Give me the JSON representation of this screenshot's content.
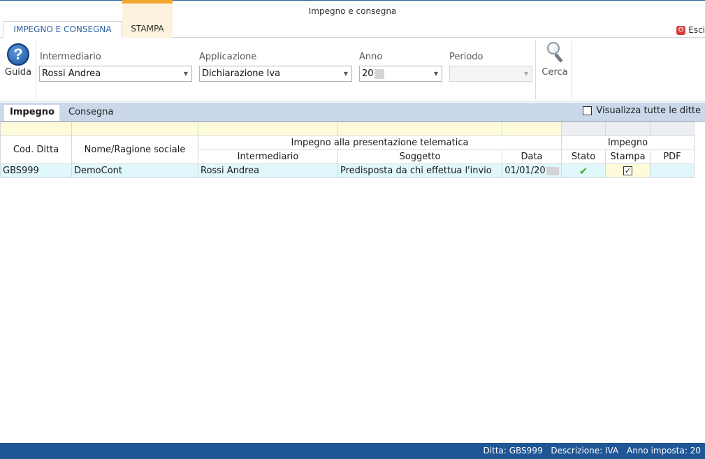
{
  "window": {
    "title": "Impegno e consegna"
  },
  "ribbon": {
    "tabs": [
      {
        "label": "IMPEGNO E CONSEGNA"
      },
      {
        "label": "STAMPA"
      }
    ],
    "exit_label": "Esci"
  },
  "toolbar": {
    "guida_label": "Guida",
    "cerca_label": "Cerca",
    "intermediario": {
      "label": "Intermediario",
      "value": "Rossi Andrea"
    },
    "applicazione": {
      "label": "Applicazione",
      "value": "Dichiarazione Iva"
    },
    "anno": {
      "label": "Anno",
      "value": "20"
    },
    "periodo": {
      "label": "Periodo",
      "value": ""
    }
  },
  "subtabs": [
    {
      "label": "Impegno"
    },
    {
      "label": "Consegna"
    }
  ],
  "show_all": {
    "label": "Visualizza tutte le ditte",
    "checked": false
  },
  "grid": {
    "group_headers": {
      "telematica": "Impegno alla presentazione telematica",
      "impegno": "Impegno"
    },
    "columns": {
      "cod_ditta": "Cod. Ditta",
      "nome": "Nome/Ragione sociale",
      "intermediario": "Intermediario",
      "soggetto": "Soggetto",
      "data": "Data",
      "stato": "Stato",
      "stampa": "Stampa",
      "pdf": "PDF"
    },
    "rows": [
      {
        "cod_ditta": "GBS999",
        "nome": "DemoCont",
        "intermediario": "Rossi Andrea",
        "soggetto": "Predisposta da chi effettua l'invio",
        "data": "01/01/20",
        "stato": "ok",
        "stampa_checked": true,
        "pdf": ""
      }
    ]
  },
  "statusbar": {
    "ditta": "Ditta: GBS999",
    "descrizione": "Descrizione: IVA",
    "anno": "Anno imposta: 20"
  },
  "colors": {
    "accent_blue": "#2a5f9e",
    "status_bar": "#1f5796",
    "stampa_tab_accent": "#f0a830",
    "row_highlight": "#e0f8fb",
    "filter_row": "#fdfbd9"
  }
}
